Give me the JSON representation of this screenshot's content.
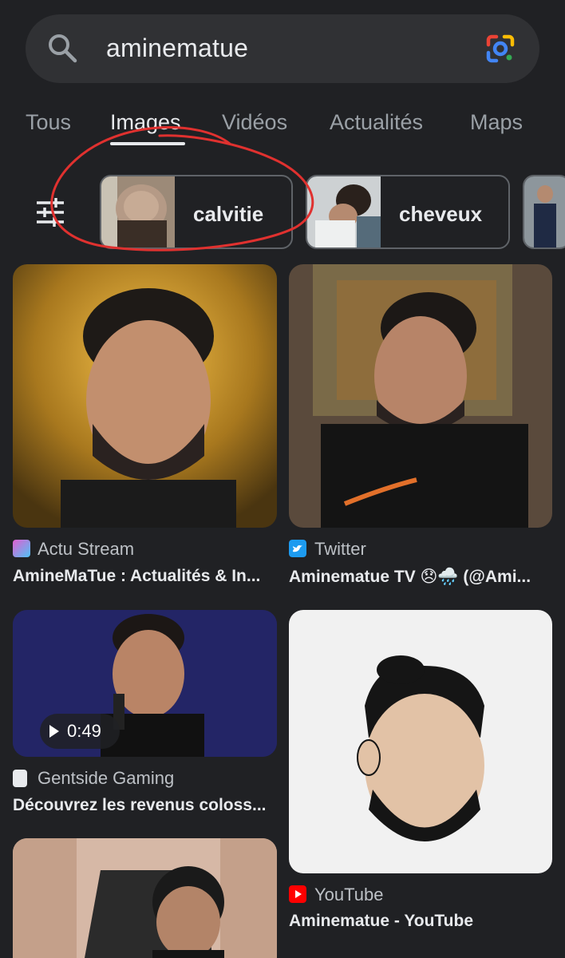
{
  "search": {
    "query": "aminematue"
  },
  "tabs": [
    {
      "label": "Tous"
    },
    {
      "label": "Images"
    },
    {
      "label": "Vidéos"
    },
    {
      "label": "Actualités"
    },
    {
      "label": "Maps"
    }
  ],
  "chips": [
    {
      "label": "calvitie"
    },
    {
      "label": "cheveux"
    }
  ],
  "results": [
    {
      "source": "Actu Stream",
      "title": "AmineMaTue : Actualités & In..."
    },
    {
      "source": "Twitter",
      "title": "Aminematue TV 😞🌧️ (@Ami..."
    },
    {
      "source": "Gentside Gaming",
      "title": "Découvrez les revenus coloss...",
      "video_duration": "0:49"
    },
    {
      "source": "YouTube",
      "title": "Aminematue - YouTube"
    }
  ],
  "colors": {
    "background": "#202124",
    "search_bg": "#303134",
    "annotation_red": "#e0312f"
  }
}
